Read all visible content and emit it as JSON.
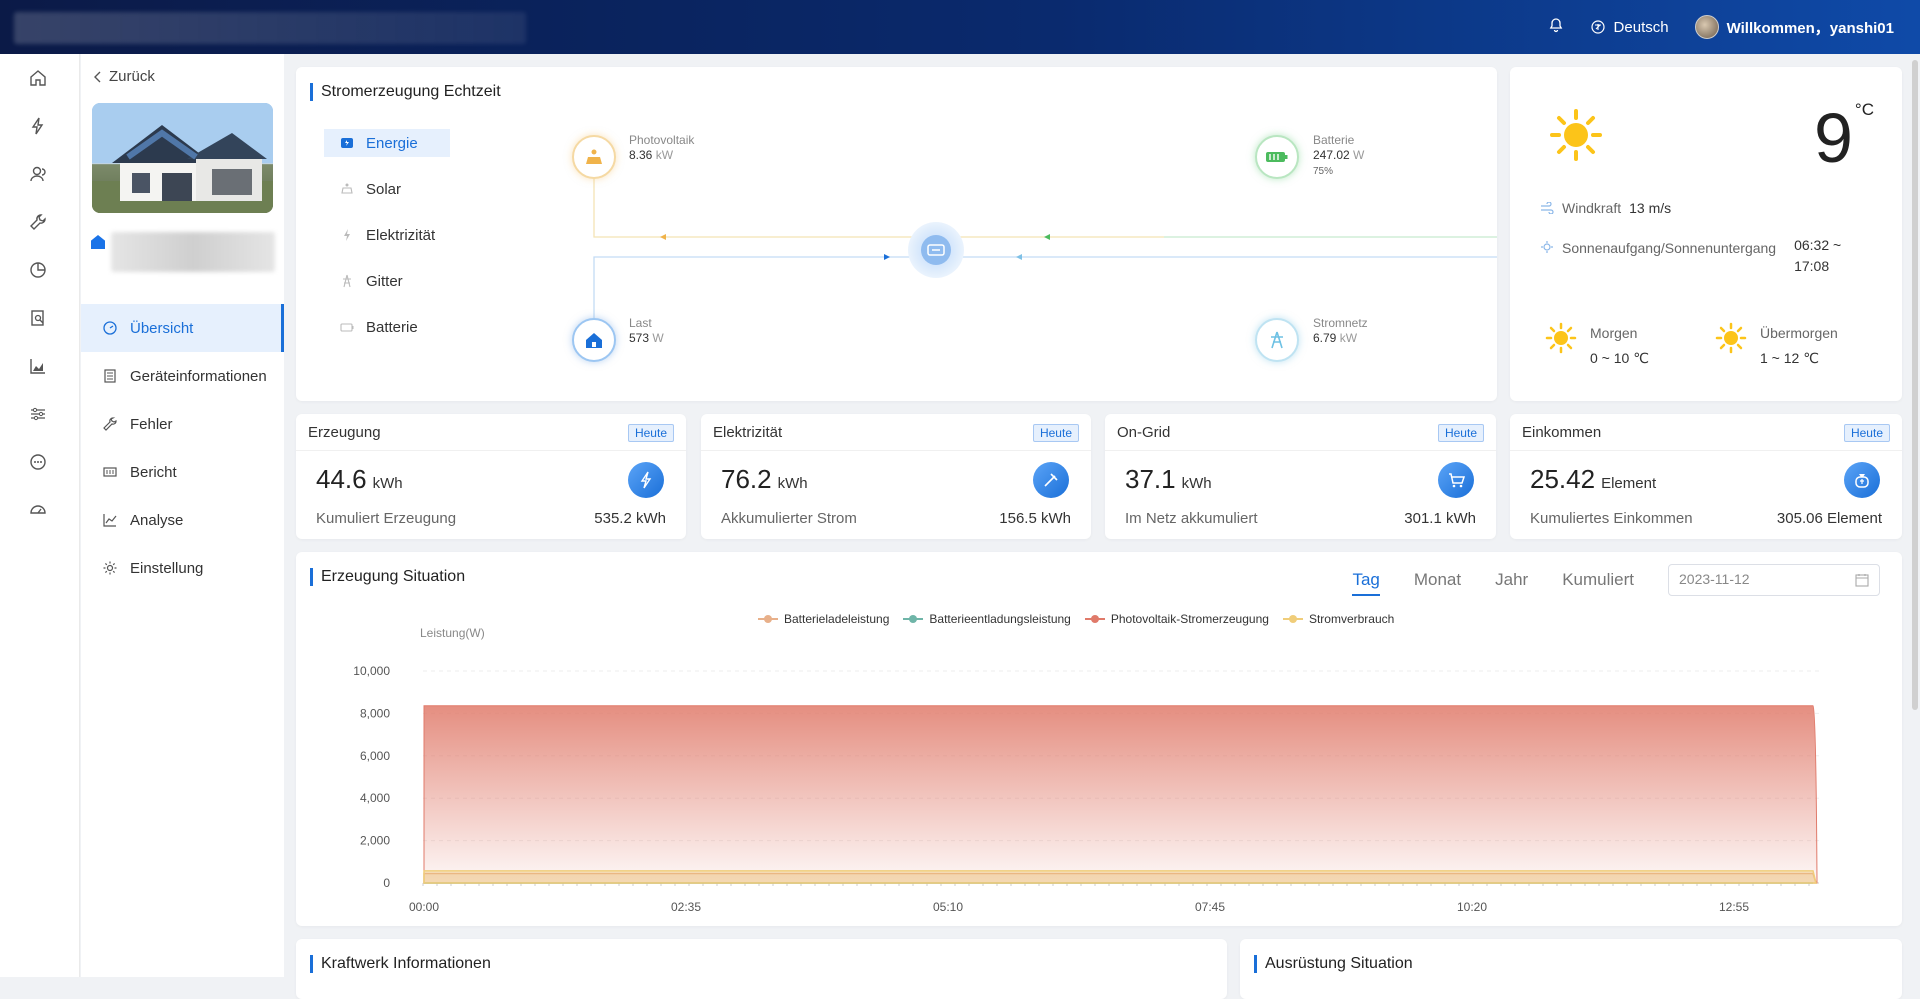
{
  "topbar": {
    "language": "Deutsch",
    "welcome": "Willkommen，yanshi01"
  },
  "sidenav": {
    "back_label": "Zurück",
    "menu": [
      {
        "label": "Übersicht",
        "icon": "dashboard-icon",
        "active": true
      },
      {
        "label": "Geräteinformationen",
        "icon": "document-icon",
        "active": false
      },
      {
        "label": "Fehler",
        "icon": "wrench-icon",
        "active": false
      },
      {
        "label": "Bericht",
        "icon": "report-icon",
        "active": false
      },
      {
        "label": "Analyse",
        "icon": "line-chart-icon",
        "active": false
      },
      {
        "label": "Einstellung",
        "icon": "gear-icon",
        "active": false
      }
    ]
  },
  "realtime": {
    "title": "Stromerzeugung Echtzeit",
    "menu": [
      "Energie",
      "Solar",
      "Elektrizität",
      "Gitter",
      "Batterie"
    ],
    "pv": {
      "name": "Photovoltaik",
      "value": "8.36",
      "unit": "kW"
    },
    "battery": {
      "name": "Batterie",
      "value": "247.02",
      "unit": "W",
      "soc": "75%"
    },
    "load": {
      "name": "Last",
      "value": "573",
      "unit": "W"
    },
    "grid": {
      "name": "Stromnetz",
      "value": "6.79",
      "unit": "kW"
    }
  },
  "weather": {
    "temp": "9",
    "temp_unit": "°C",
    "wind_label": "Windkraft",
    "wind_value": "13 m/s",
    "sun_label": "Sonnenaufgang/Sonnenuntergang",
    "sun_value_1": "06:32 ~",
    "sun_value_2": "17:08",
    "tomorrow_label": "Morgen",
    "tomorrow_value": "0 ~ 10 ℃",
    "after_label": "Übermorgen",
    "after_value": "1 ~ 12 ℃"
  },
  "stats": [
    {
      "title": "Erzeugung",
      "badge": "Heute",
      "value": "44.6",
      "unit": "kWh",
      "foot_label": "Kumuliert Erzeugung",
      "foot_value": "535.2 kWh",
      "icon": "lightning-icon"
    },
    {
      "title": "Elektrizität",
      "badge": "Heute",
      "value": "76.2",
      "unit": "kWh",
      "foot_label": "Akkumulierter Strom",
      "foot_value": "156.5 kWh",
      "icon": "plug-icon"
    },
    {
      "title": "On-Grid",
      "badge": "Heute",
      "value": "37.1",
      "unit": "kWh",
      "foot_label": "Im Netz akkumuliert",
      "foot_value": "301.1 kWh",
      "icon": "cart-icon"
    },
    {
      "title": "Einkommen",
      "badge": "Heute",
      "value": "25.42",
      "unit": "Element",
      "foot_label": "Kumuliertes Einkommen",
      "foot_value": "305.06 Element",
      "icon": "money-bag-icon"
    }
  ],
  "generation": {
    "title": "Erzeugung Situation",
    "tabs": [
      "Tag",
      "Monat",
      "Jahr",
      "Kumuliert"
    ],
    "active_tab": "Tag",
    "date": "2023-11-12"
  },
  "chart_data": {
    "type": "area",
    "ylabel": "Leistung(W)",
    "ylim": [
      0,
      10000
    ],
    "y_ticks": [
      "10,000",
      "8,000",
      "6,000",
      "4,000",
      "2,000",
      "0"
    ],
    "x_ticks": [
      "00:00",
      "02:35",
      "05:10",
      "07:45",
      "10:20",
      "12:55"
    ],
    "legend_position": "top-center",
    "series": [
      {
        "name": "Batterieladeleistung",
        "color": "#e8b08a",
        "values": [
          450,
          450,
          450,
          450,
          450,
          450,
          450
        ]
      },
      {
        "name": "Batterieentladungsleistung",
        "color": "#6fb5a8",
        "values": [
          0,
          0,
          0,
          0,
          0,
          0,
          0
        ]
      },
      {
        "name": "Photovoltaik-Stromerzeugung",
        "color": "#e07a6a",
        "values": [
          8360,
          8360,
          8360,
          8360,
          8360,
          8360,
          8360
        ]
      },
      {
        "name": "Stromverbrauch",
        "color": "#f0cd7a",
        "values": [
          573,
          573,
          573,
          573,
          573,
          573,
          573
        ]
      }
    ]
  },
  "bottom": {
    "left_title": "Kraftwerk Informationen",
    "right_title": "Ausrüstung Situation"
  }
}
